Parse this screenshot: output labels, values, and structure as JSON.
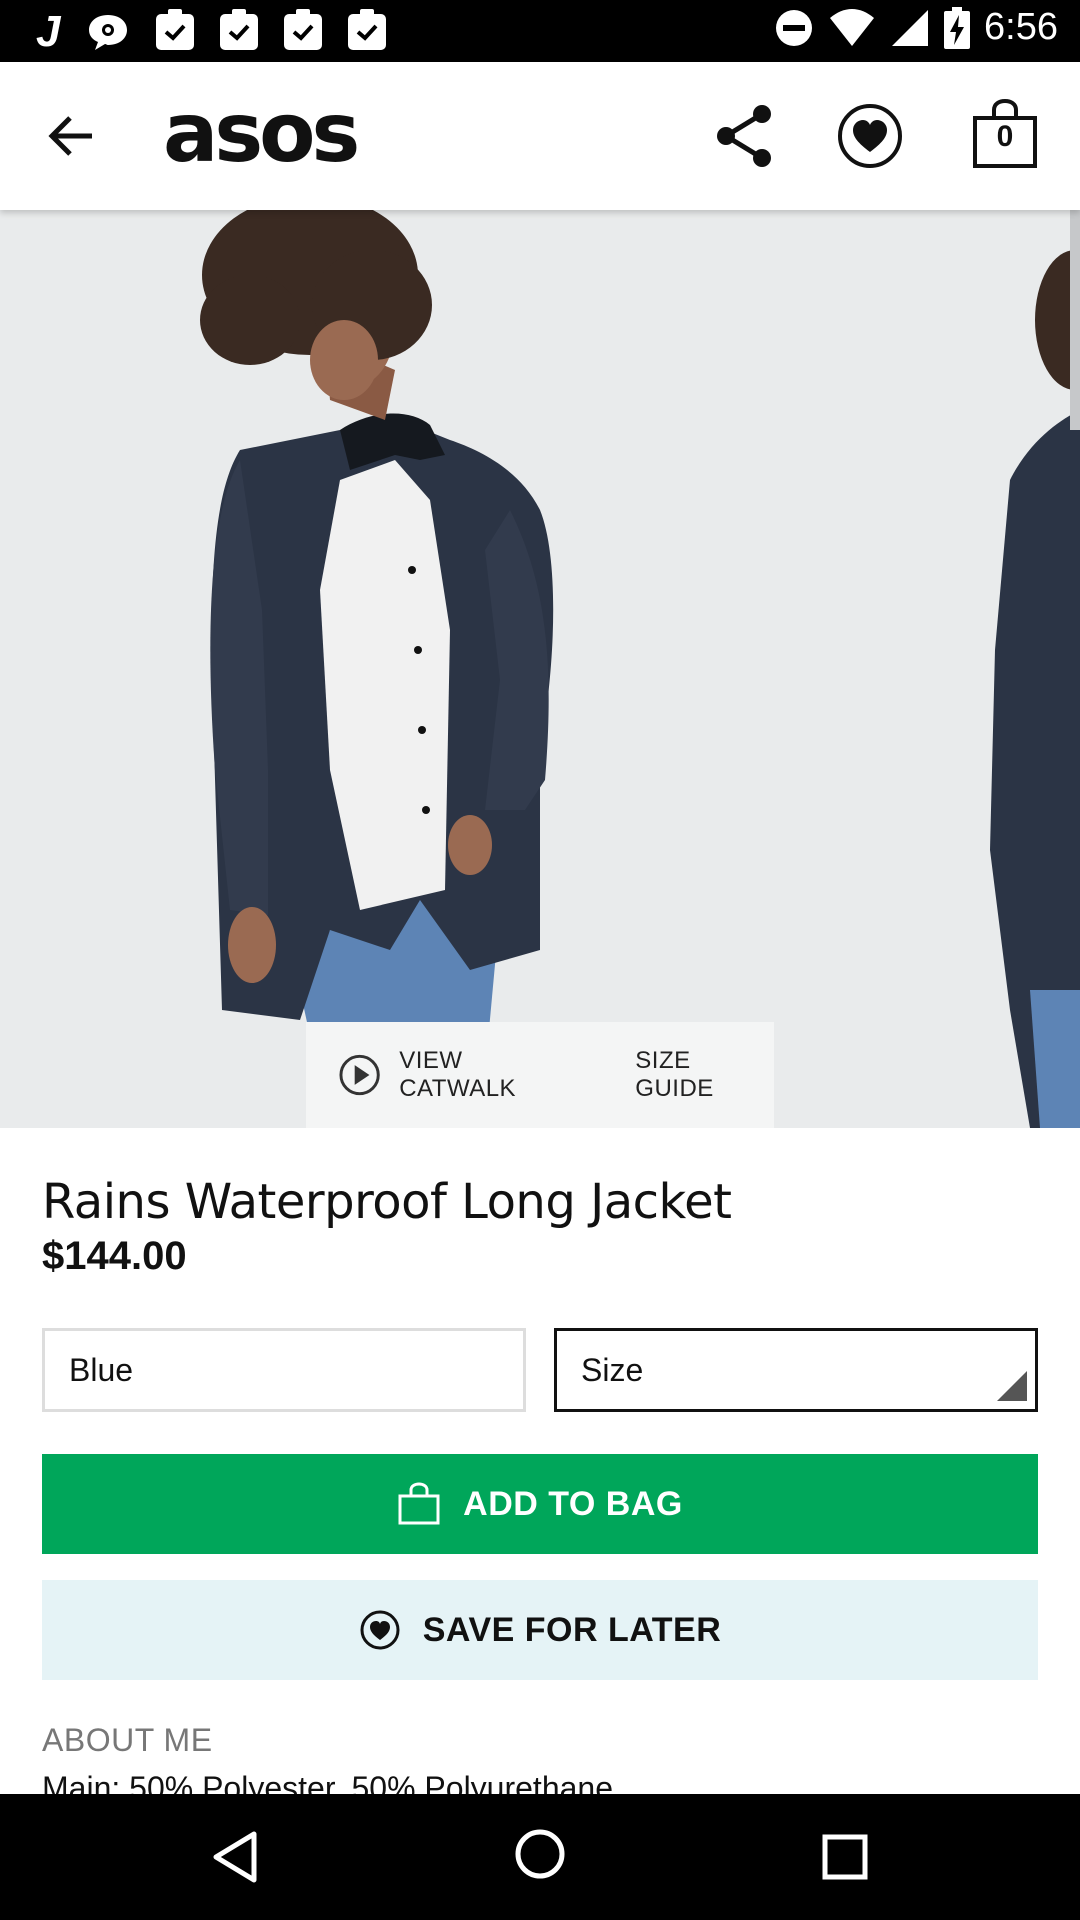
{
  "status_bar": {
    "time": "6:56",
    "notification_icons": [
      "j-app-icon",
      "chat-icon",
      "clipboard-check-icon",
      "clipboard-check-icon",
      "clipboard-check-icon",
      "clipboard-check-icon"
    ],
    "system_icons": [
      "do-not-disturb-icon",
      "wifi-icon",
      "signal-icon",
      "battery-charging-icon"
    ]
  },
  "app_bar": {
    "logo": "asos",
    "bag_count": "0",
    "icons": [
      "back-arrow-icon",
      "share-icon",
      "heart-icon",
      "bag-icon"
    ]
  },
  "hero": {
    "view_catwalk": "VIEW CATWALK",
    "size_guide": "SIZE GUIDE"
  },
  "product": {
    "title": "Rains Waterproof Long Jacket",
    "price": "$144.00",
    "colour": "Blue",
    "size_placeholder": "Size"
  },
  "actions": {
    "add_to_bag": "ADD TO BAG",
    "save_for_later": "SAVE FOR LATER"
  },
  "about": {
    "title": "ABOUT ME",
    "body": "Main: 50% Polyester, 50% Polyurethane"
  },
  "colors": {
    "accent_green": "#00a65a",
    "save_bg": "#e5f3f6",
    "hero_bg": "#e9ebec"
  }
}
